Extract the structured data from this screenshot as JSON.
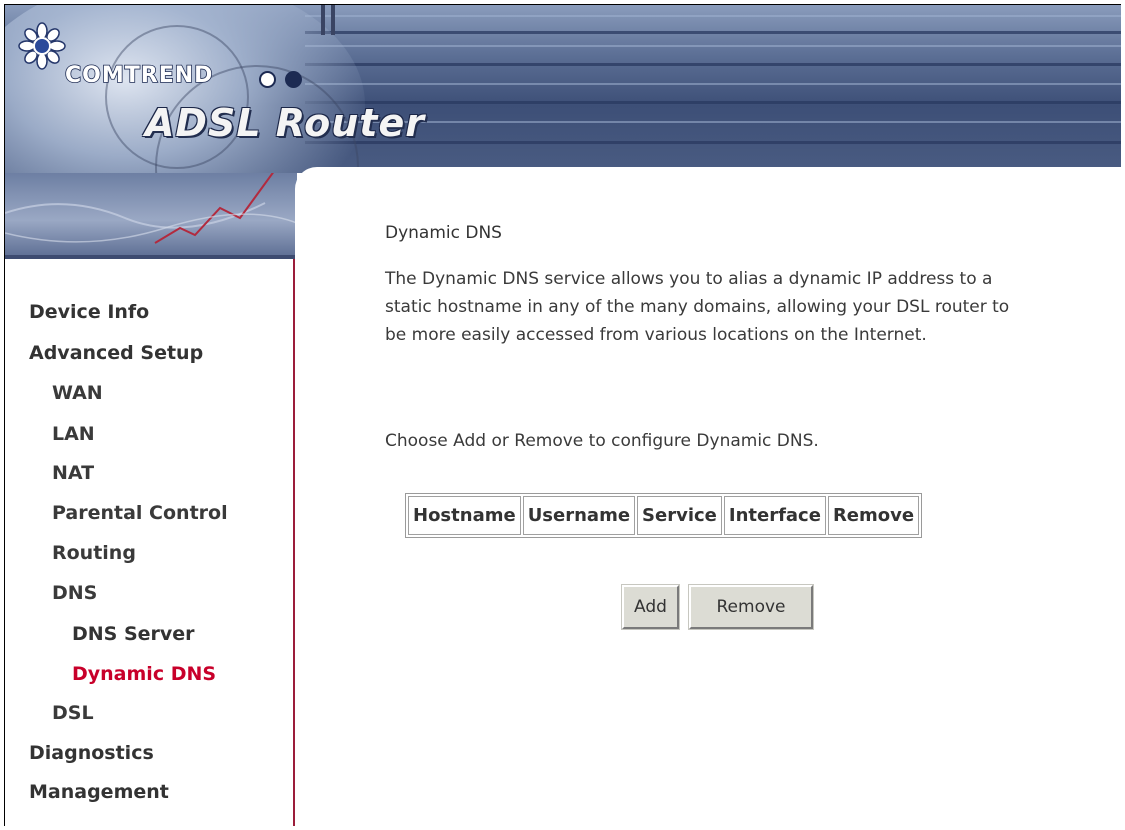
{
  "header": {
    "brand": "COMTREND",
    "product": "ADSL Router"
  },
  "colors": {
    "banner": "#3d4f77",
    "sidebar_border": "#9b1d3a",
    "nav_active": "#c8002a",
    "nav_text": "#333333"
  },
  "sidebar": {
    "items": [
      {
        "label": "Device Info",
        "level": 1
      },
      {
        "label": "Advanced Setup",
        "level": 1
      },
      {
        "label": "WAN",
        "level": 2
      },
      {
        "label": "LAN",
        "level": 2
      },
      {
        "label": "NAT",
        "level": 2
      },
      {
        "label": "Parental Control",
        "level": 2
      },
      {
        "label": "Routing",
        "level": 2
      },
      {
        "label": "DNS",
        "level": 2
      },
      {
        "label": "DNS Server",
        "level": 3
      },
      {
        "label": "Dynamic DNS",
        "level": 3,
        "active": true
      },
      {
        "label": "DSL",
        "level": 2
      },
      {
        "label": "Diagnostics",
        "level": 1
      },
      {
        "label": "Management",
        "level": 1
      }
    ]
  },
  "main": {
    "title": "Dynamic DNS",
    "description": "The Dynamic DNS service allows you to alias a dynamic IP address to a static hostname in any of the many domains, allowing your DSL router to be more easily accessed from various locations on the Internet.",
    "instruction": "Choose Add or Remove to configure Dynamic DNS.",
    "table": {
      "columns": [
        "Hostname",
        "Username",
        "Service",
        "Interface",
        "Remove"
      ],
      "rows": []
    },
    "buttons": {
      "add": "Add",
      "remove": "Remove"
    }
  }
}
